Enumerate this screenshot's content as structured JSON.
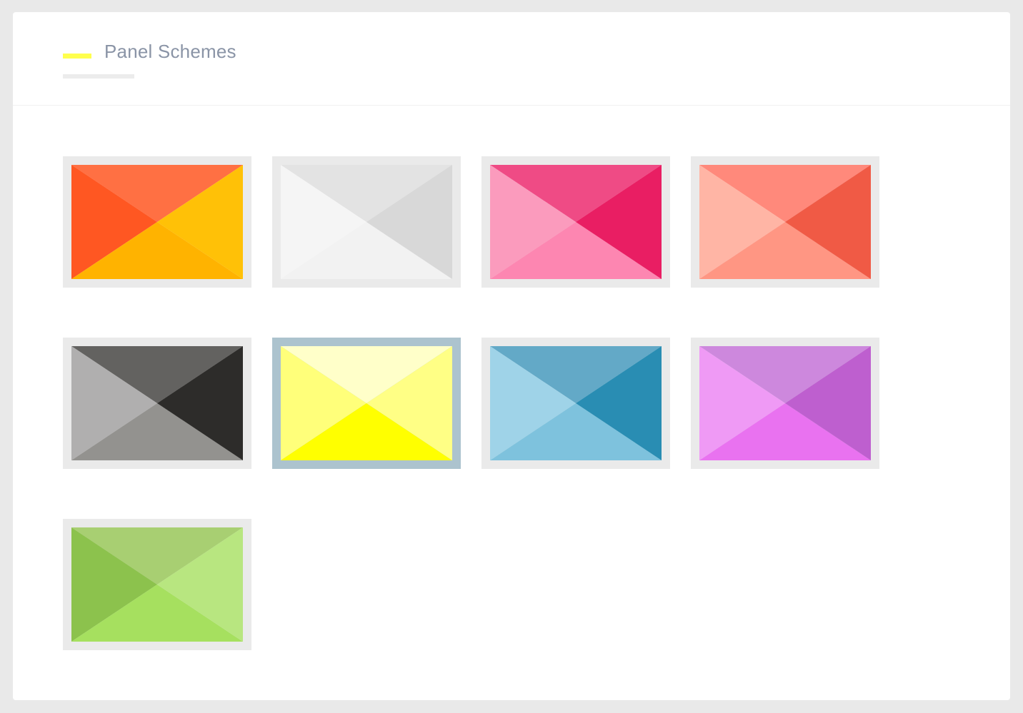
{
  "panel": {
    "title": "Panel Schemes",
    "accent_color": "#ffff4d"
  },
  "schemes": [
    {
      "name": "orange",
      "selected": false,
      "colors": {
        "top": "#ff7043",
        "left": "#ff5722",
        "bottom": "#ffb300",
        "right": "#ffc107"
      }
    },
    {
      "name": "light",
      "selected": false,
      "colors": {
        "top": "#e3e3e3",
        "left": "#f5f5f5",
        "bottom": "#f2f2f2",
        "right": "#d8d8d8"
      }
    },
    {
      "name": "pink",
      "selected": false,
      "colors": {
        "top": "#ef4b85",
        "left": "#fb9bbd",
        "bottom": "#fd86b1",
        "right": "#e91e63"
      }
    },
    {
      "name": "salmon",
      "selected": false,
      "colors": {
        "top": "#ff897b",
        "left": "#ffb5a5",
        "bottom": "#ff9683",
        "right": "#f05a45"
      }
    },
    {
      "name": "dark",
      "selected": false,
      "colors": {
        "top": "#636260",
        "left": "#b0afaf",
        "bottom": "#93928f",
        "right": "#2d2c2a"
      }
    },
    {
      "name": "yellow",
      "selected": true,
      "colors": {
        "top": "#ffffc9",
        "left": "#ffff7a",
        "bottom": "#ffff00",
        "right": "#ffff85"
      }
    },
    {
      "name": "blue",
      "selected": false,
      "colors": {
        "top": "#63a9c7",
        "left": "#9fd3e8",
        "bottom": "#7ec2dd",
        "right": "#298db3"
      }
    },
    {
      "name": "purple",
      "selected": false,
      "colors": {
        "top": "#cd88dd",
        "left": "#ef9af5",
        "bottom": "#e972f0",
        "right": "#be5fcf"
      }
    },
    {
      "name": "green",
      "selected": false,
      "colors": {
        "top": "#a8cf72",
        "left": "#8cc24d",
        "bottom": "#a6e05f",
        "right": "#b8e680"
      }
    }
  ]
}
